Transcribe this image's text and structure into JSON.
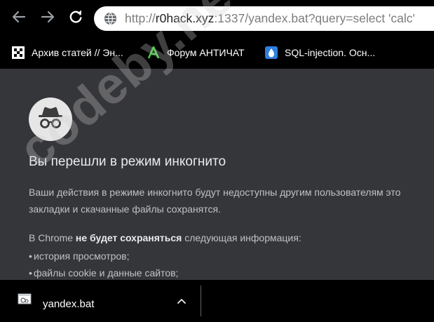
{
  "toolbar": {
    "url_scheme": "http://",
    "url_host": "r0hack.xyz",
    "url_rest": ":1337/yandex.bat?query=select 'calc'"
  },
  "bookmarks": [
    {
      "label": "Архив статей // Эн...",
      "icon": "checker-favicon-icon"
    },
    {
      "label": "Форум АНТИЧАТ",
      "icon": "antichat-a-icon"
    },
    {
      "label": "SQL-injection. Осн...",
      "icon": "drop-favicon-icon"
    }
  ],
  "incognito": {
    "heading": "Вы перешли в режим инкогнито",
    "para1_line1": "Ваши действия в режиме инкогнито будут недоступны другим пользователям это",
    "para1_line2": "закладки и скачанные файлы сохранятся.",
    "para2_pre": "В Chrome ",
    "para2_bold": "не будет сохраняться",
    "para2_post": " следующая информация:",
    "bullets": [
      "история просмотров;",
      "файлы cookie и данные сайтов;"
    ]
  },
  "watermark": "codeby.net",
  "download": {
    "filename": "yandex.bat"
  },
  "colors": {
    "bar": "#000000",
    "page": "#35363a",
    "text": "#bdc1c6",
    "heading": "#e8eaed"
  }
}
